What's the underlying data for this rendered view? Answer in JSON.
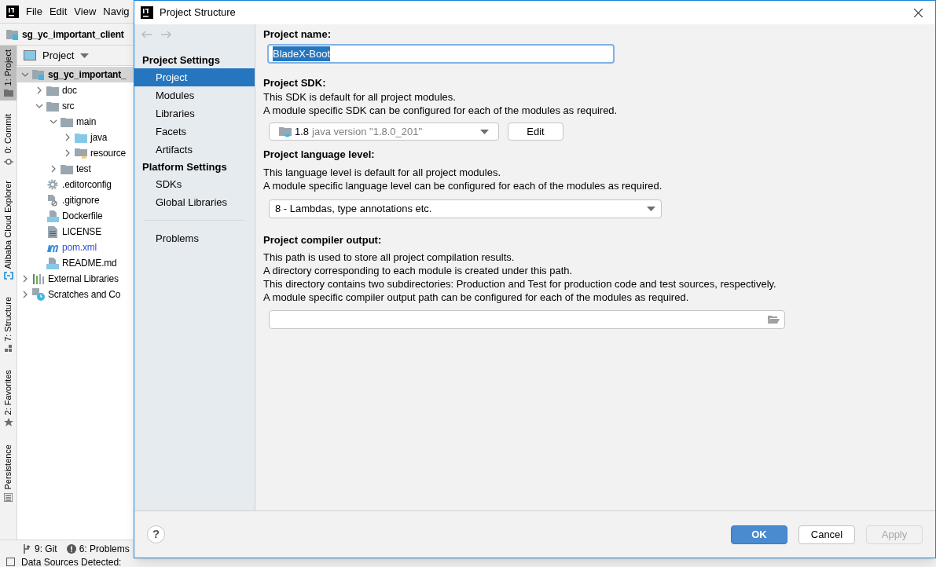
{
  "ide": {
    "menu": [
      "File",
      "Edit",
      "View",
      "Navig"
    ],
    "breadcrumb": "sg_yc_important_client",
    "tool_strip": [
      {
        "label": "1: Project",
        "kind": "folder",
        "selected": true
      },
      {
        "label": "0: Commit",
        "kind": "commit",
        "selected": false
      },
      {
        "label": "Alibaba Cloud Explorer",
        "kind": "cloud",
        "selected": false
      },
      {
        "label": "7: Structure",
        "kind": "structure",
        "selected": false
      },
      {
        "label": "2: Favorites",
        "kind": "star",
        "selected": false
      },
      {
        "label": "Persistence",
        "kind": "persistence",
        "selected": false
      }
    ],
    "project_panel": {
      "title": "Project",
      "tree": [
        {
          "label": "sg_yc_important_",
          "kind": "module",
          "expanded": true,
          "selected": true,
          "children": [
            {
              "label": "doc",
              "kind": "folder",
              "expanded": false,
              "selected": false
            },
            {
              "label": "src",
              "kind": "folder",
              "expanded": true,
              "selected": false,
              "children": [
                {
                  "label": "main",
                  "kind": "folder",
                  "expanded": true,
                  "selected": false,
                  "children": [
                    {
                      "label": "java",
                      "kind": "source_folder",
                      "expanded": false,
                      "selected": false
                    },
                    {
                      "label": "resource",
                      "kind": "resource_folder",
                      "expanded": false,
                      "selected": false
                    }
                  ]
                },
                {
                  "label": "test",
                  "kind": "folder",
                  "expanded": false,
                  "selected": false
                }
              ]
            },
            {
              "label": ".editorconfig",
              "kind": "settings",
              "selected": false
            },
            {
              "label": ".gitignore",
              "kind": "ignore",
              "selected": false
            },
            {
              "label": "Dockerfile",
              "kind": "docker",
              "selected": false
            },
            {
              "label": "LICENSE",
              "kind": "text",
              "selected": false
            },
            {
              "label": "pom.xml",
              "kind": "maven",
              "selected": false
            },
            {
              "label": "README.md",
              "kind": "markdown",
              "selected": false
            }
          ]
        },
        {
          "label": "External Libraries",
          "kind": "libraries",
          "expanded": false,
          "selected": false
        },
        {
          "label": "Scratches and Co",
          "kind": "scratches",
          "expanded": false,
          "selected": false
        }
      ]
    },
    "bottom_tools": [
      {
        "label": "9: Git",
        "kind": "git"
      },
      {
        "label": "6: Problems",
        "kind": "problems"
      }
    ],
    "status": "Data Sources Detected:"
  },
  "dialog": {
    "title": "Project Structure",
    "nav": [
      {
        "heading": "Project Settings",
        "items": [
          {
            "label": "Project",
            "selected": true
          },
          {
            "label": "Modules",
            "selected": false
          },
          {
            "label": "Libraries",
            "selected": false
          },
          {
            "label": "Facets",
            "selected": false
          },
          {
            "label": "Artifacts",
            "selected": false
          }
        ]
      },
      {
        "heading": "Platform Settings",
        "items": [
          {
            "label": "SDKs",
            "selected": false
          },
          {
            "label": "Global Libraries",
            "selected": false
          }
        ]
      }
    ],
    "nav_footer": [
      {
        "label": "Problems",
        "selected": false
      }
    ],
    "project_name": {
      "label": "Project name:",
      "value": "BladeX-Boot",
      "text_selected": true
    },
    "sdk": {
      "label": "Project SDK:",
      "lines": [
        "This SDK is default for all project modules.",
        "A module specific SDK can be configured for each of the modules as required."
      ],
      "version": "1.8",
      "detail": "java version \"1.8.0_201\"",
      "edit": "Edit"
    },
    "language_level": {
      "label": "Project language level:",
      "lines": [
        "This language level is default for all project modules.",
        "A module specific language level can be configured for each of the modules as required."
      ],
      "value": "8 - Lambdas, type annotations etc."
    },
    "compiler_output": {
      "label": "Project compiler output:",
      "lines": [
        "This path is used to store all project compilation results.",
        "A directory corresponding to each module is created under this path.",
        "This directory contains two subdirectories: Production and Test for production code and test sources, respectively.",
        "A module specific compiler output path can be configured for each of the modules as required."
      ]
    },
    "help": "?",
    "buttons": [
      {
        "label": "OK",
        "kind": "primary",
        "disabled": false
      },
      {
        "label": "Cancel",
        "kind": "normal",
        "disabled": false
      },
      {
        "label": "Apply",
        "kind": "normal",
        "disabled": true
      }
    ]
  }
}
